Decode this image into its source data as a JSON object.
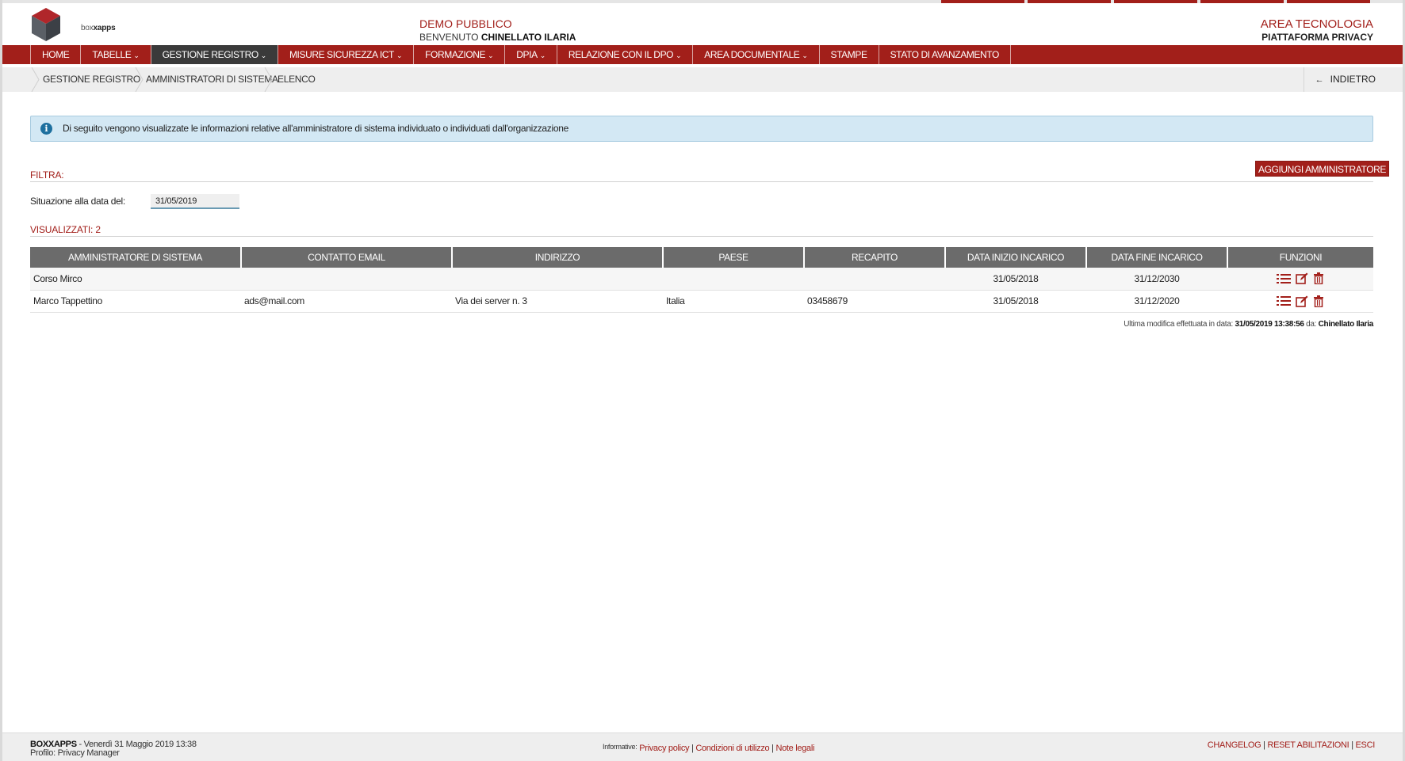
{
  "header": {
    "logo_text_light": "box",
    "logo_text_bold": "xapps",
    "center_title": "DEMO PUBBLICO",
    "welcome_prefix": "BENVENUTO",
    "welcome_user": "CHINELLATO ILARIA",
    "area_title": "AREA TECNOLOGIA",
    "platform": "PIATTAFORMA PRIVACY"
  },
  "nav": {
    "items": [
      {
        "label": "HOME",
        "dropdown": false
      },
      {
        "label": "TABELLE",
        "dropdown": true
      },
      {
        "label": "GESTIONE REGISTRO",
        "dropdown": true,
        "active": true
      },
      {
        "label": "MISURE SICUREZZA ICT",
        "dropdown": true
      },
      {
        "label": "FORMAZIONE",
        "dropdown": true
      },
      {
        "label": "DPIA",
        "dropdown": true
      },
      {
        "label": "RELAZIONE CON IL DPO",
        "dropdown": true
      },
      {
        "label": "AREA DOCUMENTALE",
        "dropdown": true
      },
      {
        "label": "STAMPE",
        "dropdown": false
      },
      {
        "label": "STATO DI AVANZAMENTO",
        "dropdown": false
      }
    ],
    "caret": "⌄"
  },
  "breadcrumb": {
    "items": [
      "GESTIONE REGISTRO",
      "AMMINISTRATORI DI SISTEMA",
      "ELENCO"
    ],
    "back_label": "INDIETRO",
    "back_icon": "←"
  },
  "info": {
    "icon": "i",
    "text": "Di seguito vengono visualizzate le informazioni relative all'amministratore di sistema individuato o individuati dall'organizzazione"
  },
  "filter": {
    "title": "FILTRA:",
    "add_button": "AGGIUNGI AMMINISTRATORE",
    "date_label": "Situazione alla data del:",
    "date_value": "31/05/2019"
  },
  "results": {
    "title": "VISUALIZZATI: 2"
  },
  "table": {
    "headers": [
      "AMMINISTRATORE DI SISTEMA",
      "CONTATTO EMAIL",
      "INDIRIZZO",
      "PAESE",
      "RECAPITO",
      "DATA INIZIO INCARICO",
      "DATA FINE INCARICO",
      "FUNZIONI"
    ],
    "rows": [
      {
        "name": "Corso Mirco",
        "email": "",
        "address": "",
        "country": "",
        "phone": "",
        "start": "31/05/2018",
        "end": "31/12/2030"
      },
      {
        "name": "Marco Tappettino",
        "email": "ads@mail.com",
        "address": "Via dei server n. 3",
        "country": "Italia",
        "phone": "03458679",
        "start": "31/05/2018",
        "end": "31/12/2020"
      }
    ]
  },
  "last_modified": {
    "prefix": "Ultima modifica effettuata in data:",
    "datetime": "31/05/2019 13:38:56",
    "by_label": "da:",
    "user": "Chinellato Ilaria"
  },
  "footer": {
    "brand": "BOXXAPPS",
    "date_text": "- Venerdì 31 Maggio 2019 13:38",
    "profile": "Profilo: Privacy Manager",
    "informative_label": "Informative:",
    "links": [
      "Privacy policy",
      "Condizioni di utilizzo",
      "Note legali"
    ],
    "right_links": [
      "CHANGELOG",
      "RESET ABILITAZIONI",
      "ESCI"
    ]
  },
  "colors": {
    "brand_red": "#a21f1a",
    "nav_active": "#3a3a3a",
    "table_header": "#6b6b6b",
    "info_bg": "#d3e8f4"
  }
}
